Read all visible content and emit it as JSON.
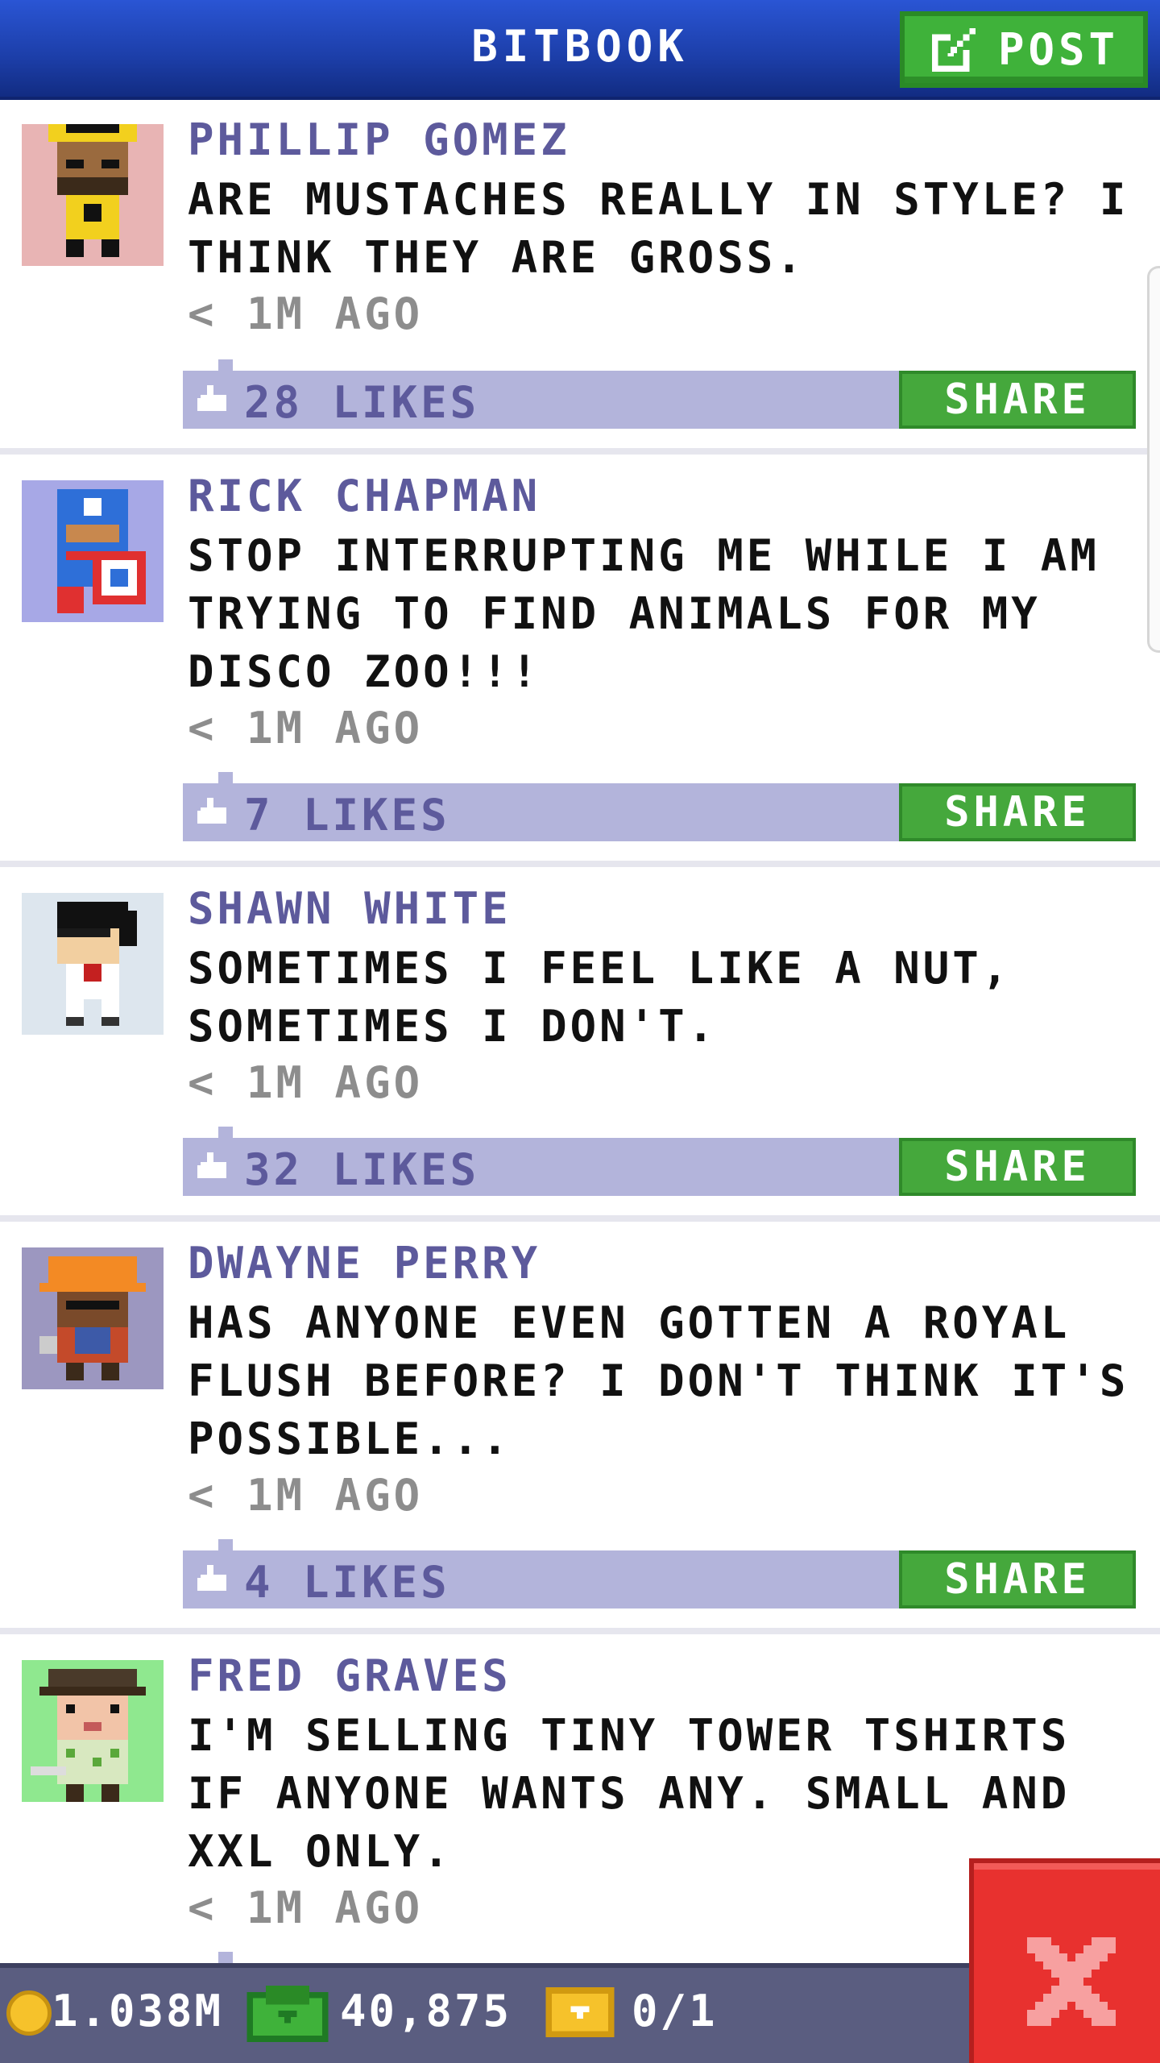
{
  "header": {
    "title": "BITBOOK",
    "post_label": "POST"
  },
  "posts": [
    {
      "author": "PHILLIP GOMEZ",
      "message": "ARE MUSTACHES REALLY IN STYLE? I THINK THEY ARE GROSS.",
      "time": "< 1M AGO",
      "likes": "28 LIKES",
      "share_label": "SHARE",
      "avatar_bg": "#e8b4b4"
    },
    {
      "author": "RICK CHAPMAN",
      "message": "STOP INTERRUPTING ME WHILE I AM TRYING TO FIND ANIMALS FOR MY DISCO ZOO!!!",
      "time": "< 1M AGO",
      "likes": "7 LIKES",
      "share_label": "SHARE",
      "avatar_bg": "#a7a8e6"
    },
    {
      "author": "SHAWN WHITE",
      "message": "SOMETIMES I FEEL LIKE A NUT, SOMETIMES I DON'T.",
      "time": "< 1M AGO",
      "likes": "32 LIKES",
      "share_label": "SHARE",
      "avatar_bg": "#dde6ee"
    },
    {
      "author": "DWAYNE PERRY",
      "message": "HAS ANYONE EVEN GOTTEN A ROYAL FLUSH BEFORE? I DON'T THINK IT'S POSSIBLE...",
      "time": "< 1M AGO",
      "likes": "4 LIKES",
      "share_label": "SHARE",
      "avatar_bg": "#9c97c0"
    },
    {
      "author": "FRED GRAVES",
      "message": "I'M SELLING TINY TOWER TSHIRTS IF ANYONE WANTS ANY. SMALL AND XXL ONLY.",
      "time": "< 1M AGO",
      "avatar_bg": "#8fe88f"
    }
  ],
  "status_bar": {
    "coins": "1.038M",
    "bux": "40,875",
    "tickets": "0/1"
  },
  "colors": {
    "header_blue": "#1c3ea8",
    "accent_green": "#45a83c",
    "likes_bar": "#b3b4db",
    "author_purple": "#5d5a9c",
    "close_red": "#e8312f"
  },
  "icons": {
    "post": "edit-icon",
    "like": "thumbs-up-icon",
    "coin": "coin-icon",
    "bux": "bux-icon",
    "ticket": "ticket-icon",
    "close": "close-icon"
  }
}
